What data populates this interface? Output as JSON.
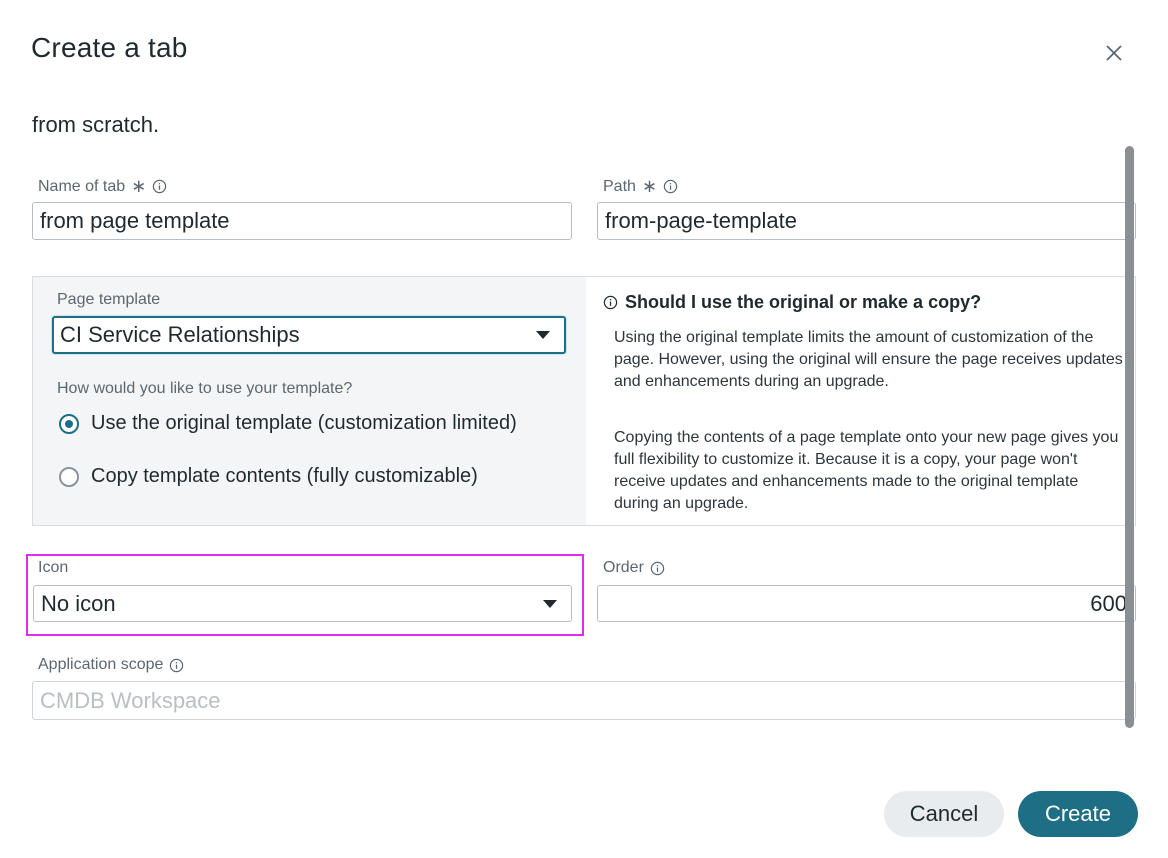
{
  "dialog": {
    "title": "Create a tab",
    "intro_text": "from scratch."
  },
  "fields": {
    "name": {
      "label": "Name of tab",
      "required_mark": "∗",
      "value": "from page template"
    },
    "path": {
      "label": "Path",
      "required_mark": "∗",
      "value": "from-page-template"
    },
    "page_template": {
      "label": "Page template",
      "selected": "CI Service Relationships",
      "question": "How would you like to use your template?",
      "options": [
        {
          "label": "Use the original template (customization limited)",
          "checked": true
        },
        {
          "label": "Copy template contents (fully customizable)",
          "checked": false
        }
      ]
    },
    "icon": {
      "label": "Icon",
      "selected": "No icon"
    },
    "order": {
      "label": "Order",
      "value": "600"
    },
    "application_scope": {
      "label": "Application scope",
      "value": "CMDB Workspace"
    }
  },
  "help": {
    "title": "Should I use the original or make a copy?",
    "paragraphs": [
      "Using the original template limits the amount of customization of the page. However, using the original will ensure the page receives updates and enhancements during an upgrade.",
      "Copying the contents of a page template onto your new page gives you full flexibility to customize it. Because it is a copy, your page won't receive updates and enhancements made to the original template during an upgrade."
    ]
  },
  "buttons": {
    "cancel": "Cancel",
    "create": "Create"
  },
  "colors": {
    "accent": "#1e6f86",
    "highlight": "#e22be8",
    "cancel_bg": "#e9ecee"
  },
  "icons": [
    "close-icon",
    "info-icon",
    "chevron-down-icon"
  ]
}
